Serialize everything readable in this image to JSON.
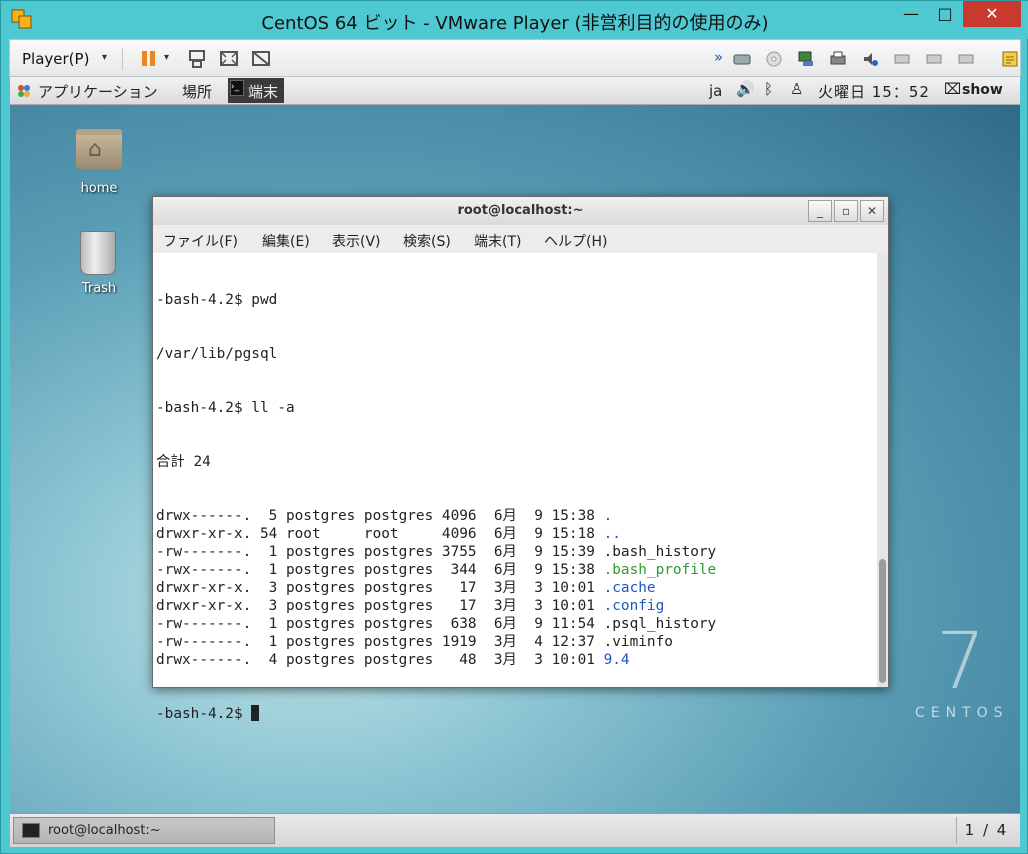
{
  "window": {
    "title": "CentOS 64 ビット - VMware Player (非営利目的の使用のみ)",
    "minimize_glyph": "—",
    "maximize_glyph": "□",
    "close_glyph": "✕"
  },
  "toolbar": {
    "player_menu": "Player(P)",
    "caret": "▾",
    "overflow_glyph": "»"
  },
  "gnome_panel": {
    "applications": "アプリケーション",
    "places": "場所",
    "terminal_launcher": "端末",
    "terminal_icon_glyph": "›_",
    "keyboard_layout": "ja",
    "volume_glyph": "🔊",
    "bluetooth_glyph": "ᛒ",
    "user_glyph": "♙",
    "clock": "火曜日 15：52",
    "show_glyph": "⌧",
    "show": "show"
  },
  "desktop": {
    "icons": [
      {
        "label": "home"
      },
      {
        "label": "Trash"
      }
    ],
    "branding_number": "7",
    "branding_word": "CENTOS"
  },
  "terminal": {
    "title": "root@localhost:~",
    "minimize_glyph": "_",
    "maximize_glyph": "▫",
    "close_glyph": "✕",
    "menu": [
      "ファイル(F)",
      "編集(E)",
      "表示(V)",
      "検索(S)",
      "端末(T)",
      "ヘルプ(H)"
    ],
    "lines": [
      "-bash-4.2$ pwd",
      "/var/lib/pgsql",
      "-bash-4.2$ ll -a",
      "合計 24"
    ],
    "entries": [
      {
        "perm": "drwx------.",
        "links": " 5",
        "owner": "postgres",
        "group": "postgres",
        "size": "4096",
        "month": " 6月",
        "day": " 9",
        "time": "15:38",
        "name": ".",
        "color": "blue"
      },
      {
        "perm": "drwxr-xr-x.",
        "links": "54",
        "owner": "root    ",
        "group": "root    ",
        "size": "4096",
        "month": " 6月",
        "day": " 9",
        "time": "15:18",
        "name": "..",
        "color": "blue"
      },
      {
        "perm": "-rw-------.",
        "links": " 1",
        "owner": "postgres",
        "group": "postgres",
        "size": "3755",
        "month": " 6月",
        "day": " 9",
        "time": "15:39",
        "name": ".bash_history",
        "color": "plain"
      },
      {
        "perm": "-rwx------.",
        "links": " 1",
        "owner": "postgres",
        "group": "postgres",
        "size": " 344",
        "month": " 6月",
        "day": " 9",
        "time": "15:38",
        "name": ".bash_profile",
        "color": "green"
      },
      {
        "perm": "drwxr-xr-x.",
        "links": " 3",
        "owner": "postgres",
        "group": "postgres",
        "size": "  17",
        "month": " 3月",
        "day": " 3",
        "time": "10:01",
        "name": ".cache",
        "color": "blue"
      },
      {
        "perm": "drwxr-xr-x.",
        "links": " 3",
        "owner": "postgres",
        "group": "postgres",
        "size": "  17",
        "month": " 3月",
        "day": " 3",
        "time": "10:01",
        "name": ".config",
        "color": "blue"
      },
      {
        "perm": "-rw-------.",
        "links": " 1",
        "owner": "postgres",
        "group": "postgres",
        "size": " 638",
        "month": " 6月",
        "day": " 9",
        "time": "11:54",
        "name": ".psql_history",
        "color": "plain"
      },
      {
        "perm": "-rw-------.",
        "links": " 1",
        "owner": "postgres",
        "group": "postgres",
        "size": "1919",
        "month": " 3月",
        "day": " 4",
        "time": "12:37",
        "name": ".viminfo",
        "color": "plain"
      },
      {
        "perm": "drwx------.",
        "links": " 4",
        "owner": "postgres",
        "group": "postgres",
        "size": "  48",
        "month": " 3月",
        "day": " 3",
        "time": "10:01",
        "name": "9.4",
        "color": "blue"
      }
    ],
    "prompt": "-bash-4.2$ "
  },
  "taskbar": {
    "task_label": "root@localhost:~",
    "workspace": "1 / 4"
  },
  "colors": {
    "vmware_frame": "#4ec9d2",
    "close_red": "#c8392e",
    "dir_blue": "#1a56c8",
    "exec_green": "#2f9b2f"
  }
}
